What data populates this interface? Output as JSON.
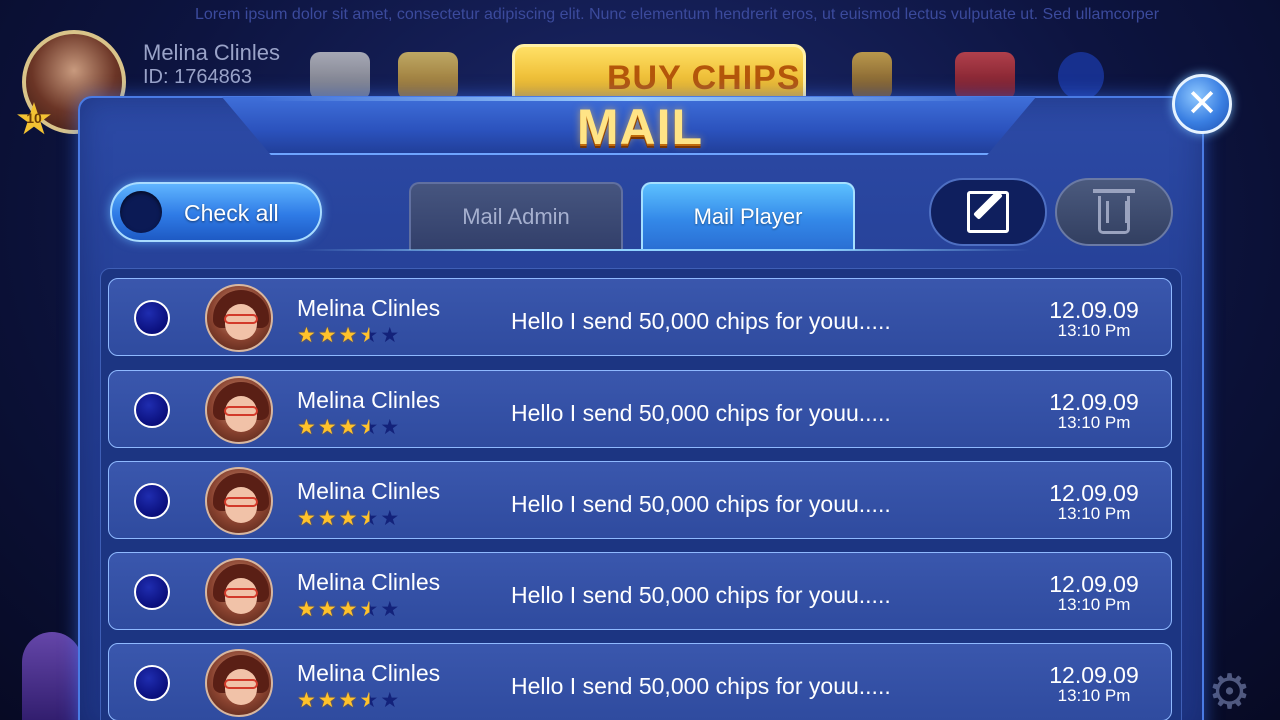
{
  "background": {
    "ticker": "Lorem ipsum dolor sit amet, consectetur adipiscing elit. Nunc elementum hendrerit eros, ut euismod lectus vulputate ut. Sed ullamcorper",
    "player_name": "Melina Clinles",
    "player_id": "ID: 1764863",
    "level": "10",
    "buy_chips_label": "BUY CHIPS",
    "icons": [
      "megaphone-icon",
      "gift-code-icon",
      "hourglass-icon",
      "gift-box-icon",
      "messenger-icon",
      "settings-gear-icon"
    ]
  },
  "modal": {
    "title": "MAIL",
    "close_icon": "close-icon",
    "check_all_label": "Check all",
    "tabs": [
      {
        "label": "Mail Admin",
        "active": false
      },
      {
        "label": "Mail Player",
        "active": true
      }
    ],
    "compose_icon": "compose-icon",
    "delete_icon": "trash-icon"
  },
  "mails": [
    {
      "sender": "Melina Clinles",
      "rating": 3.5,
      "rating_max": 5,
      "message": "Hello I send 50,000 chips for youu.....",
      "date": "12.09.09",
      "time": "13:10 Pm",
      "checked": false
    },
    {
      "sender": "Melina Clinles",
      "rating": 3.5,
      "rating_max": 5,
      "message": "Hello I send 50,000 chips for youu.....",
      "date": "12.09.09",
      "time": "13:10 Pm",
      "checked": false
    },
    {
      "sender": "Melina Clinles",
      "rating": 3.5,
      "rating_max": 5,
      "message": "Hello I send 50,000 chips for youu.....",
      "date": "12.09.09",
      "time": "13:10 Pm",
      "checked": false
    },
    {
      "sender": "Melina Clinles",
      "rating": 3.5,
      "rating_max": 5,
      "message": "Hello I send 50,000 chips for youu.....",
      "date": "12.09.09",
      "time": "13:10 Pm",
      "checked": false
    },
    {
      "sender": "Melina Clinles",
      "rating": 3.5,
      "rating_max": 5,
      "message": "Hello I send 50,000 chips for youu.....",
      "date": "12.09.09",
      "time": "13:10 Pm",
      "checked": false
    }
  ],
  "colors": {
    "modal_bg": "#243e93",
    "active_tab": "#3388e8",
    "star": "#ffc22b",
    "title_gold": "#ffe486"
  }
}
